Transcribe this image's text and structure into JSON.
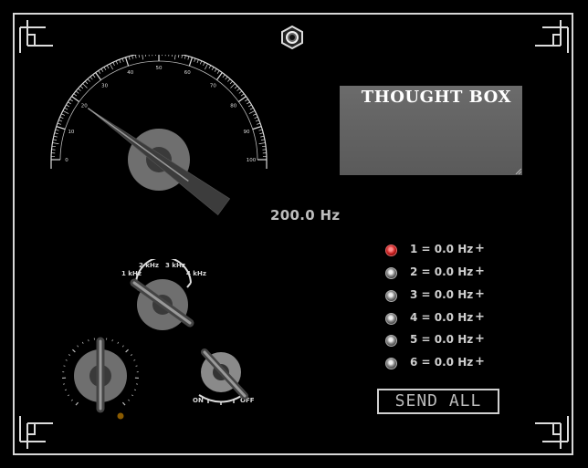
{
  "display": {
    "title": "THOUGHT BOX",
    "frequency_readout": "200.0 Hz"
  },
  "gauge": {
    "ticks": [
      "0",
      "10",
      "20",
      "30",
      "40",
      "50",
      "60",
      "70",
      "80",
      "90",
      "100"
    ],
    "min": 0,
    "max": 100,
    "needle_value": 20
  },
  "range_knob": {
    "labels": [
      "1 kHz",
      "2 kHz",
      "3 kHz",
      "4 kHz"
    ]
  },
  "power_switch": {
    "on_label": "ON",
    "off_label": "OFF"
  },
  "presets": [
    {
      "label": "1 = 0.0 Hz",
      "active": true
    },
    {
      "label": "2 = 0.0 Hz",
      "active": false
    },
    {
      "label": "3 = 0.0 Hz",
      "active": false
    },
    {
      "label": "4 = 0.0 Hz",
      "active": false
    },
    {
      "label": "5 = 0.0 Hz",
      "active": false
    },
    {
      "label": "6 = 0.0 Hz",
      "active": false
    }
  ],
  "preset_add_symbol": "+",
  "send_all_label": "SEND ALL",
  "colors": {
    "background": "#000000",
    "frame": "#d8d8d8",
    "knob_body": "#6f6f6f",
    "indicator_active": "#cc2222"
  }
}
